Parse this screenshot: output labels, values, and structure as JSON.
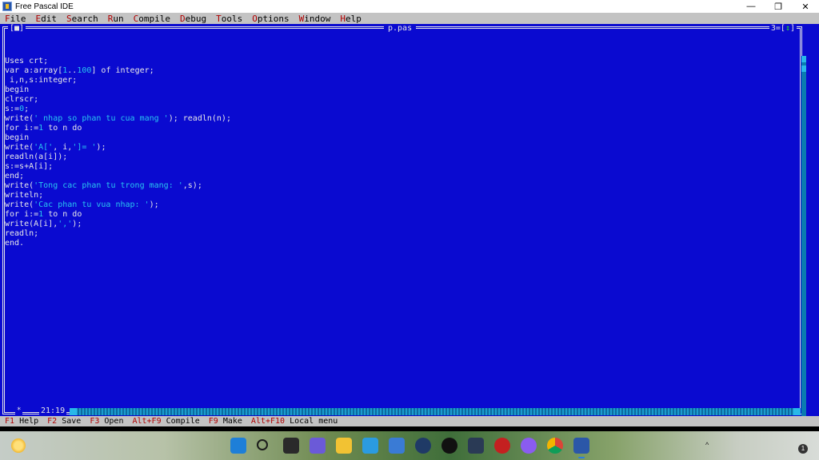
{
  "window": {
    "title": "Free Pascal IDE",
    "minimize": "—",
    "restore": "❐",
    "close": "✕"
  },
  "menu": [
    {
      "hotkey": "F",
      "rest": "ile"
    },
    {
      "hotkey": "E",
      "rest": "dit"
    },
    {
      "hotkey": "S",
      "rest": "earch"
    },
    {
      "hotkey": "R",
      "rest": "un"
    },
    {
      "hotkey": "C",
      "rest": "ompile"
    },
    {
      "hotkey": "D",
      "rest": "ebug"
    },
    {
      "hotkey": "T",
      "rest": "ools"
    },
    {
      "hotkey": "O",
      "rest": "ptions"
    },
    {
      "hotkey": "W",
      "rest": "indow"
    },
    {
      "hotkey": "H",
      "rest": "elp"
    }
  ],
  "editor": {
    "close_button": "[■]",
    "file_name": "p.pas",
    "window_number": "3=[",
    "window_zoom": "↕",
    "window_number_close": "]",
    "modified_mark": "*",
    "cursor_position": "21:19",
    "code_lines": [
      [
        {
          "t": "Uses crt;"
        }
      ],
      [
        {
          "t": "var a:array["
        },
        {
          "t": "1",
          "c": "num"
        },
        {
          "t": ".."
        },
        {
          "t": "100",
          "c": "num"
        },
        {
          "t": "] of integer;"
        }
      ],
      [
        {
          "t": " i,n,s:integer;"
        }
      ],
      [
        {
          "t": "begin"
        }
      ],
      [
        {
          "t": "clrscr;"
        }
      ],
      [
        {
          "t": "s:="
        },
        {
          "t": "0",
          "c": "num"
        },
        {
          "t": ";"
        }
      ],
      [
        {
          "t": "write("
        },
        {
          "t": "' nhap so phan tu cua mang '",
          "c": "tx"
        },
        {
          "t": "); readln(n);"
        }
      ],
      [
        {
          "t": "for i:="
        },
        {
          "t": "1",
          "c": "num"
        },
        {
          "t": " to n do"
        }
      ],
      [
        {
          "t": "begin"
        }
      ],
      [
        {
          "t": "write("
        },
        {
          "t": "'A['",
          "c": "tx"
        },
        {
          "t": ", i,"
        },
        {
          "t": "']= '",
          "c": "tx"
        },
        {
          "t": ");"
        }
      ],
      [
        {
          "t": "readln(a[i]);"
        }
      ],
      [
        {
          "t": "s:=s+A[i];"
        }
      ],
      [
        {
          "t": "end;"
        }
      ],
      [
        {
          "t": "write("
        },
        {
          "t": "'Tong cac phan tu trong mang: '",
          "c": "tx"
        },
        {
          "t": ",s);"
        }
      ],
      [
        {
          "t": "writeln;"
        }
      ],
      [
        {
          "t": "write("
        },
        {
          "t": "'Cac phan tu vua nhap: '",
          "c": "tx"
        },
        {
          "t": ");"
        }
      ],
      [
        {
          "t": "for i:="
        },
        {
          "t": "1",
          "c": "num"
        },
        {
          "t": " to n do"
        }
      ],
      [
        {
          "t": "write(A[i],"
        },
        {
          "t": "','",
          "c": "tx"
        },
        {
          "t": ");"
        }
      ],
      [
        {
          "t": "readln;"
        }
      ],
      [
        {
          "t": "end."
        }
      ]
    ]
  },
  "function_keys": [
    {
      "key": "F1",
      "label": " Help"
    },
    {
      "key": "F2",
      "label": " Save"
    },
    {
      "key": "F3",
      "label": " Open"
    },
    {
      "key": "Alt+F9",
      "label": " Compile"
    },
    {
      "key": "F9",
      "label": " Make"
    },
    {
      "key": "Alt+F10",
      "label": " Local menu"
    }
  ],
  "taskbar": {
    "icons": [
      {
        "name": "start-icon",
        "color": "#1e7fd8"
      },
      {
        "name": "search-icon",
        "color": "#1b1b1b"
      },
      {
        "name": "task-view-icon",
        "color": "#2a2a2a"
      },
      {
        "name": "teams-chat-icon",
        "color": "#6b5ad8"
      },
      {
        "name": "file-explorer-icon",
        "color": "#f2c233"
      },
      {
        "name": "edge-icon",
        "color": "#2b9be0"
      },
      {
        "name": "store-icon",
        "color": "#3a7bd5"
      },
      {
        "name": "app-c-icon",
        "color": "#1f3a66"
      },
      {
        "name": "tiktok-icon",
        "color": "#111111"
      },
      {
        "name": "terminal-icon",
        "color": "#2a3a55"
      },
      {
        "name": "antivirus-icon",
        "color": "#c42020"
      },
      {
        "name": "messenger-icon",
        "color": "#8a5cf0"
      },
      {
        "name": "chrome-icon",
        "color": "#e8b020"
      },
      {
        "name": "free-pascal-icon",
        "color": "#2b57a8"
      }
    ],
    "notification_count": "1"
  }
}
